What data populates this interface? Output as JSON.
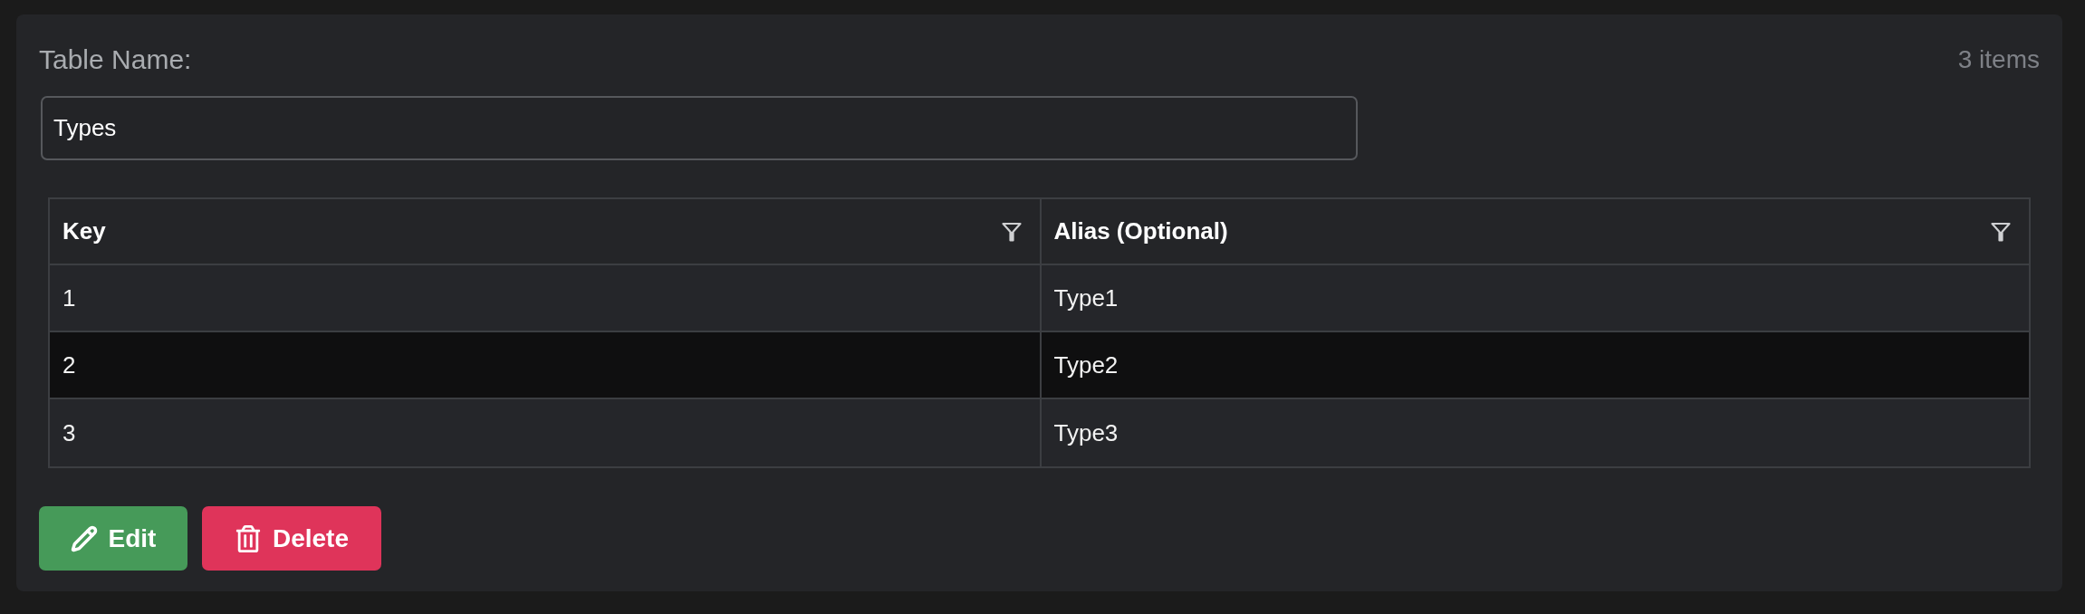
{
  "form": {
    "label": "Table Name:",
    "item_count": "3 items",
    "table_name": {
      "value": "Types"
    }
  },
  "table": {
    "columns": [
      {
        "label": "Key"
      },
      {
        "label": "Alias (Optional)"
      }
    ],
    "rows": [
      {
        "cells": [
          "1",
          "Type1"
        ],
        "highlighted": false
      },
      {
        "cells": [
          "2",
          "Type2"
        ],
        "highlighted": true
      },
      {
        "cells": [
          "3",
          "Type3"
        ],
        "highlighted": false
      }
    ]
  },
  "buttons": [
    {
      "kind": "edit",
      "label": "Edit"
    },
    {
      "kind": "delete",
      "label": "Delete"
    }
  ]
}
